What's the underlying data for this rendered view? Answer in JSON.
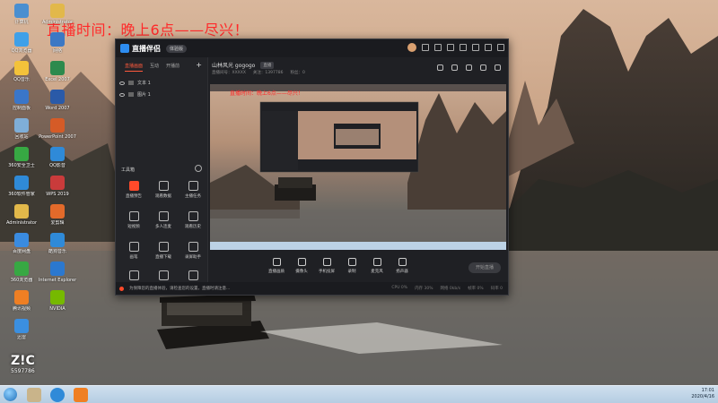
{
  "overlay_text": "直播时间：晚上6点——尽兴！",
  "desktop_icons": [
    {
      "label": "计算机",
      "color": "#4a8fd0"
    },
    {
      "label": "Administrator",
      "color": "#e2b84a"
    },
    {
      "label": "QQ浏览器",
      "color": "#3fa0e8"
    },
    {
      "label": "网络",
      "color": "#3c78c4"
    },
    {
      "label": "QQ音乐",
      "color": "#f3c23a"
    },
    {
      "label": "Excel 2007",
      "color": "#2d8a4d"
    },
    {
      "label": "控制面板",
      "color": "#3a76c9"
    },
    {
      "label": "Word 2007",
      "color": "#2a5aa8"
    },
    {
      "label": "回收站",
      "color": "#7faed8"
    },
    {
      "label": "PowerPoint 2007",
      "color": "#d55b27"
    },
    {
      "label": "360安全卫士",
      "color": "#37a843"
    },
    {
      "label": "QQ影音",
      "color": "#2f8ad8"
    },
    {
      "label": "360软件管家",
      "color": "#2f8ad8"
    },
    {
      "label": "WPS 2019",
      "color": "#c93b3b"
    },
    {
      "label": "Administrator",
      "color": "#e2b84a"
    },
    {
      "label": "爱剪辑",
      "color": "#e36a2a"
    },
    {
      "label": "百度网盘",
      "color": "#3a8be0"
    },
    {
      "label": "酷狗音乐",
      "color": "#2f8ad8"
    },
    {
      "label": "360浏览器",
      "color": "#37a843"
    },
    {
      "label": "Internet Explorer",
      "color": "#2b78cf"
    },
    {
      "label": "腾讯视频",
      "color": "#ef7f23"
    },
    {
      "label": "NVIDIA",
      "color": "#76b900"
    },
    {
      "label": "迅雷",
      "color": "#3b8fe0"
    }
  ],
  "watermark": {
    "logo": "Z!C",
    "number": "5597786"
  },
  "app": {
    "title": "直播伴侣",
    "version": "体验版",
    "tabs": [
      "直播画面",
      "互动",
      "开播前",
      "+"
    ],
    "sources": [
      {
        "label": "文本 1"
      },
      {
        "label": "图片 1"
      }
    ],
    "toolbox_label": "工具箱",
    "tools": [
      {
        "label": "直播预告",
        "accent": true
      },
      {
        "label": "观看数据",
        "accent": false
      },
      {
        "label": "主播任务",
        "accent": false
      },
      {
        "label": "短视频",
        "accent": false
      },
      {
        "label": "多人连麦",
        "accent": false
      },
      {
        "label": "观看历史",
        "accent": false
      },
      {
        "label": "画笔",
        "accent": false
      },
      {
        "label": "直播下载",
        "accent": false
      },
      {
        "label": "录屏助手",
        "accent": false
      },
      {
        "label": "…",
        "accent": false
      },
      {
        "label": "+",
        "accent": false
      },
      {
        "label": "…",
        "accent": false
      }
    ],
    "room_title": "山林风光 gogogo",
    "room_tag": "直播",
    "room_meta": [
      "直播间号：XXXXX",
      "关注：1397786",
      "粉丝：0"
    ],
    "controls": [
      {
        "label": "直播画质"
      },
      {
        "label": "摄像头"
      },
      {
        "label": "手机投屏"
      },
      {
        "label": "录制"
      },
      {
        "label": "麦克风"
      },
      {
        "label": "扬声器"
      }
    ],
    "start_label": "开始直播",
    "notice": "为保障您的直播体验，请检查您的设置，直播时请注意...",
    "status": [
      "CPU 0%",
      "内存 30%",
      "网络 0kb/s",
      "帧率 0%",
      "码率 0"
    ]
  },
  "tray": {
    "time": "17:01",
    "date": "2020/4/16"
  }
}
